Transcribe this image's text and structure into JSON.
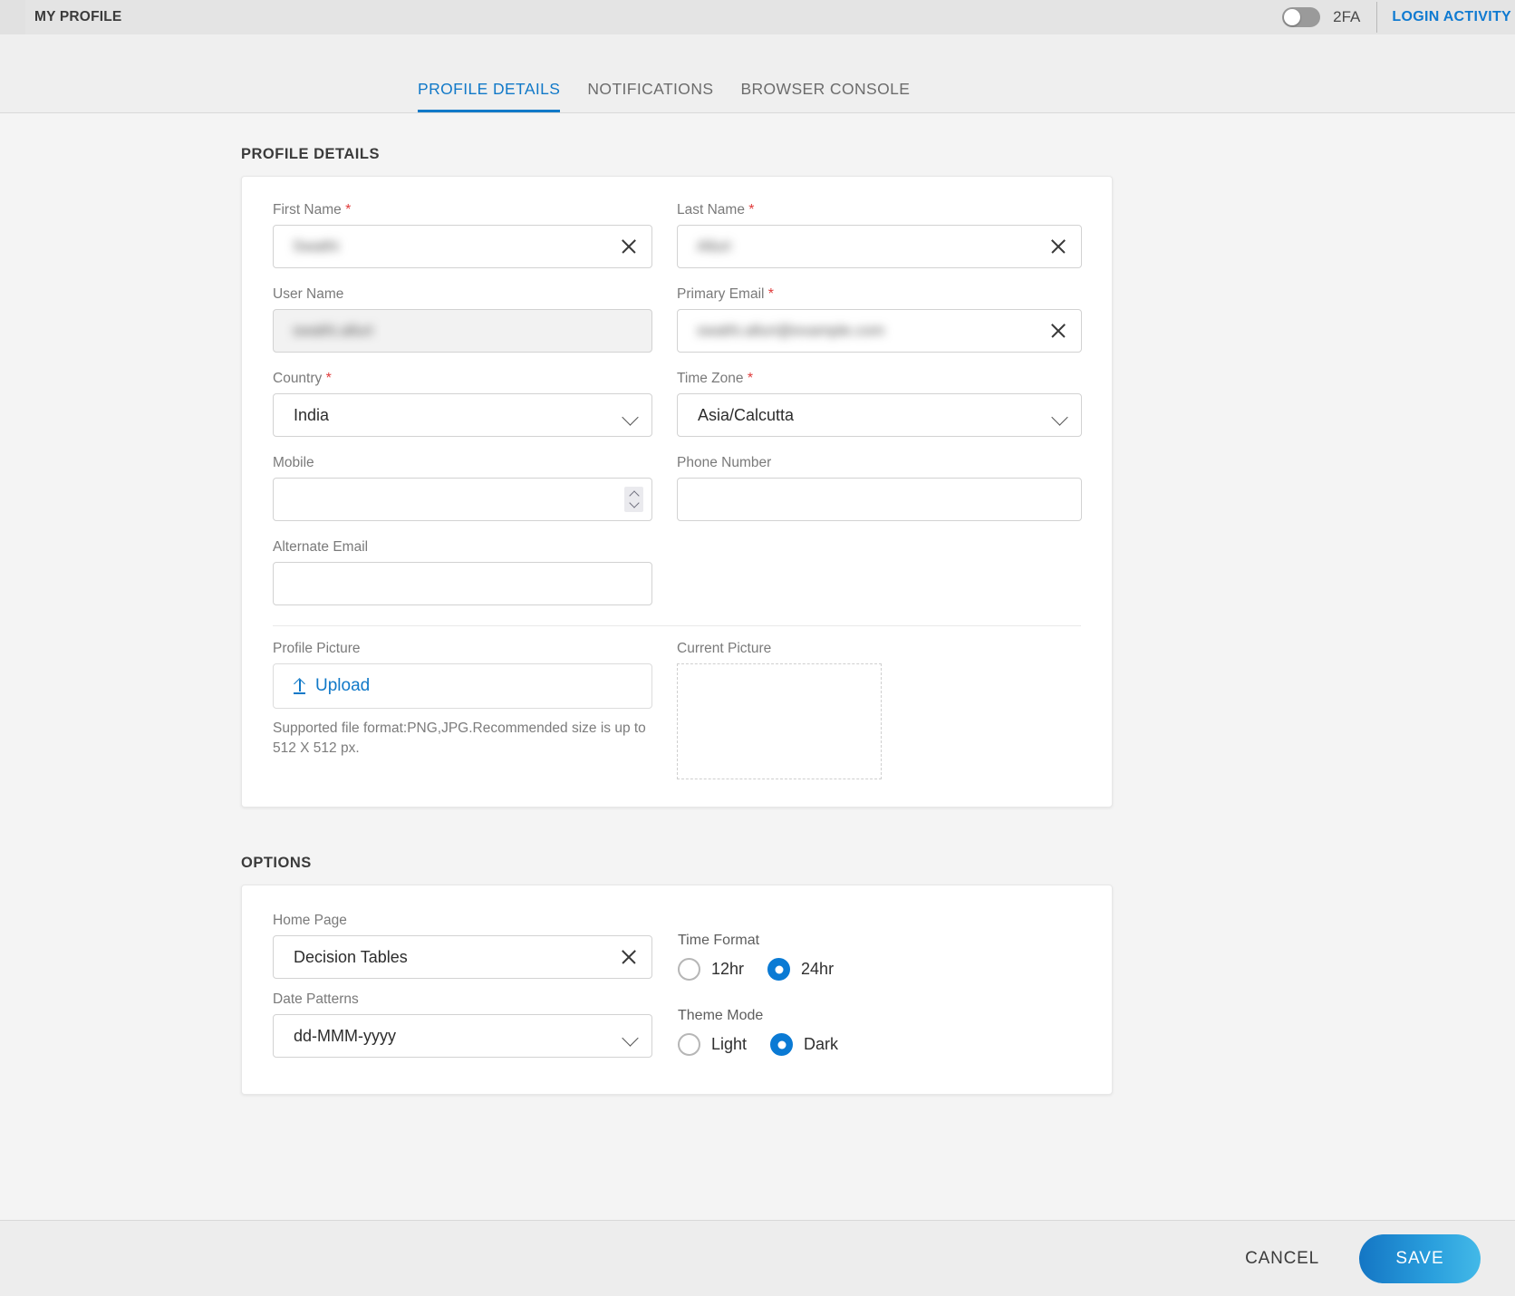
{
  "topbar": {
    "title": "MY PROFILE",
    "twofa_label": "2FA",
    "twofa_state": "off",
    "login_activity_label": "LOGIN ACTIVITY"
  },
  "tabs": [
    {
      "label": "PROFILE DETAILS",
      "active": true
    },
    {
      "label": "NOTIFICATIONS",
      "active": false
    },
    {
      "label": "BROWSER CONSOLE",
      "active": false
    }
  ],
  "profile_section": {
    "heading": "PROFILE DETAILS",
    "fields": {
      "first_name": {
        "label": "First Name",
        "required": "*",
        "value": "Swathi"
      },
      "last_name": {
        "label": "Last Name",
        "required": "*",
        "value": "Alluri"
      },
      "user_name": {
        "label": "User Name",
        "value": "swathi.alluri",
        "disabled": true
      },
      "primary_email": {
        "label": "Primary Email",
        "required": "*",
        "value": "swathi.alluri@example.com"
      },
      "country": {
        "label": "Country",
        "required": "*",
        "value": "India"
      },
      "time_zone": {
        "label": "Time Zone",
        "required": "*",
        "value": "Asia/Calcutta"
      },
      "mobile": {
        "label": "Mobile",
        "value": ""
      },
      "phone_number": {
        "label": "Phone Number",
        "value": ""
      },
      "alternate_email": {
        "label": "Alternate Email",
        "value": ""
      }
    },
    "picture": {
      "profile_picture_label": "Profile Picture",
      "upload_label": "Upload",
      "help_text": "Supported file format:PNG,JPG.Recommended size is up to 512 X 512 px.",
      "current_picture_label": "Current Picture"
    }
  },
  "options_section": {
    "heading": "OPTIONS",
    "home_page": {
      "label": "Home Page",
      "value": "Decision Tables"
    },
    "date_patterns": {
      "label": "Date Patterns",
      "value": "dd-MMM-yyyy"
    },
    "time_format": {
      "label": "Time Format",
      "options": [
        {
          "label": "12hr",
          "selected": false
        },
        {
          "label": "24hr",
          "selected": true
        }
      ]
    },
    "theme_mode": {
      "label": "Theme Mode",
      "options": [
        {
          "label": "Light",
          "selected": false
        },
        {
          "label": "Dark",
          "selected": true
        }
      ]
    }
  },
  "footer": {
    "cancel_label": "CANCEL",
    "save_label": "SAVE"
  },
  "colors": {
    "accent": "#1179c8",
    "required": "#e03b3b",
    "radio_selected": "#0a7ad4",
    "save_gradient_start": "#1476c4",
    "save_gradient_end": "#43b9e8"
  }
}
